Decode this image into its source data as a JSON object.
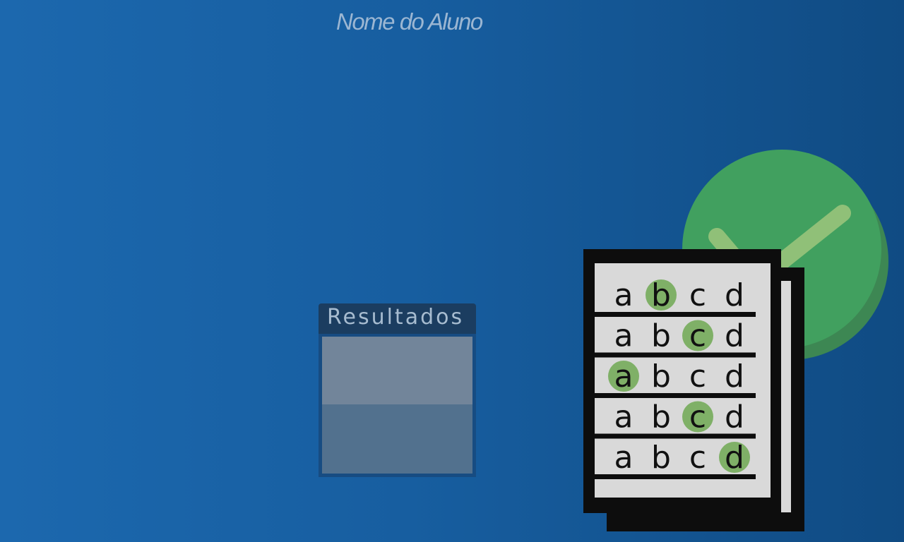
{
  "header": {
    "student_name": "Nome do Aluno"
  },
  "results": {
    "title": "Resultados"
  },
  "illustration": {
    "icons": [
      "answer-sheet-icon",
      "check-badge-icon"
    ],
    "colors": {
      "badge": "#41a05f",
      "check": "#90c078",
      "highlight": "#7fb067",
      "sheet": "#0d0d0d",
      "paper": "#d9d9d9"
    },
    "rows": [
      {
        "letters": [
          "a",
          "b",
          "c",
          "d"
        ],
        "selected": 1
      },
      {
        "letters": [
          "a",
          "b",
          "c",
          "d"
        ],
        "selected": 2
      },
      {
        "letters": [
          "a",
          "b",
          "c",
          "d"
        ],
        "selected": 0
      },
      {
        "letters": [
          "a",
          "b",
          "c",
          "d"
        ],
        "selected": 2
      },
      {
        "letters": [
          "a",
          "b",
          "c",
          "d"
        ],
        "selected": 3
      }
    ]
  }
}
